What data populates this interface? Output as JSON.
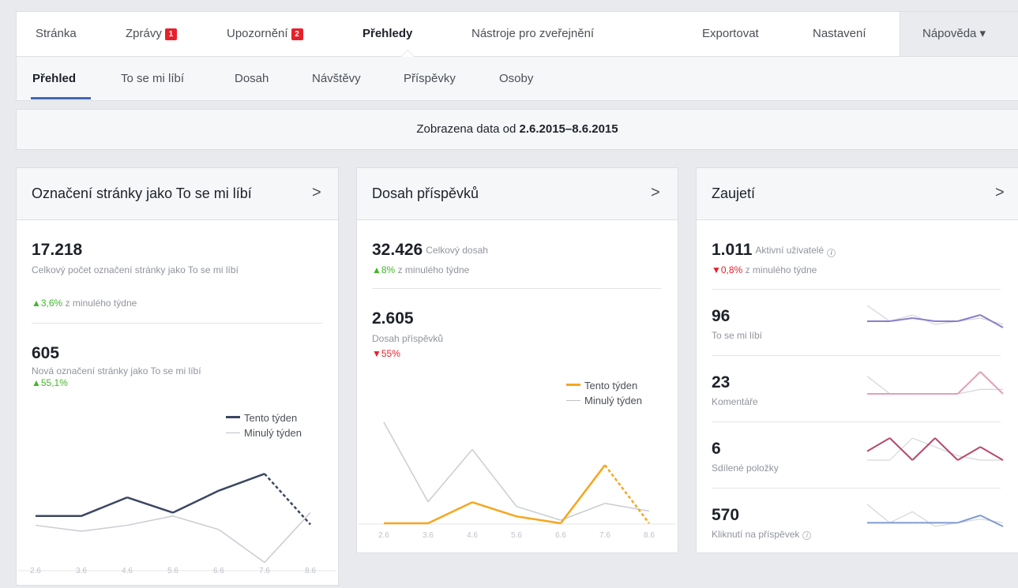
{
  "nav": {
    "items": [
      {
        "label": "Stránka"
      },
      {
        "label": "Zprávy",
        "badge": "1"
      },
      {
        "label": "Upozornění",
        "badge": "2"
      },
      {
        "label": "Přehledy"
      },
      {
        "label": "Nástroje pro zveřejnění"
      }
    ],
    "right": [
      {
        "label": "Exportovat"
      },
      {
        "label": "Nastavení"
      }
    ],
    "help": "Nápověda ▾"
  },
  "subnav": {
    "items": [
      {
        "label": "Přehled"
      },
      {
        "label": "To se mi líbí"
      },
      {
        "label": "Dosah"
      },
      {
        "label": "Návštěvy"
      },
      {
        "label": "Příspěvky"
      },
      {
        "label": "Osoby"
      }
    ]
  },
  "range": {
    "prefix": "Zobrazena data od ",
    "value": "2.6.2015–8.6.2015"
  },
  "likes_card": {
    "title": "Označení stránky jako To se mi líbí",
    "chevron": ">",
    "total": "17.218",
    "total_label": "Celkový počet označení stránky jako To se mi líbí",
    "total_change": "▲3,6%",
    "total_change_suffix": " z minulého týdne",
    "new": "605",
    "new_label": "Nová označení stránky jako To se mi líbí",
    "new_change": "▲55,1%",
    "legend_current": "Tento týden",
    "legend_previous": "Minulý týden"
  },
  "reach_card": {
    "title": "Dosah příspěvků",
    "chevron": ">",
    "total": "32.426",
    "total_label": "Celkový dosah",
    "total_change": "▲8%",
    "total_change_suffix": " z minulého týdne",
    "posts": "2.605",
    "posts_label": "Dosah příspěvků",
    "posts_change": "▼55%",
    "legend_current": "Tento týden",
    "legend_previous": "Minulý týden"
  },
  "engagement_card": {
    "title": "Zaujetí",
    "chevron": ">",
    "active": "1.011",
    "active_label": "Aktivní uživatelé",
    "active_change": "▼0,8%",
    "active_change_suffix": " z minulého týdne",
    "rows": [
      {
        "value": "96",
        "label": "To se mi líbí"
      },
      {
        "value": "23",
        "label": "Komentáře"
      },
      {
        "value": "6",
        "label": "Sdílené položky"
      },
      {
        "value": "570",
        "label": "Kliknutí na příspěvek"
      }
    ]
  },
  "colors": {
    "likes_current": "#3b4762",
    "reach_current": "#f7a61c",
    "previous": "#c9ccd2",
    "spark_likes": "#8b7fc9",
    "spark_comments": "#e3a0b8",
    "spark_shares": "#b54a6e",
    "spark_clicks": "#7f9bd3"
  },
  "chart_data": [
    {
      "type": "line",
      "x": [
        "2.6",
        "3.6",
        "4.6",
        "5.6",
        "6.6",
        "7.6",
        "8.6"
      ],
      "series": [
        {
          "name": "Tento týden",
          "values": [
            108,
            108,
            130,
            112,
            138,
            158,
            98
          ],
          "partial_last": true
        },
        {
          "name": "Minulý týden",
          "values": [
            97,
            90,
            97,
            108,
            92,
            53,
            112
          ]
        }
      ]
    },
    {
      "type": "line",
      "x": [
        "2.6",
        "3.6",
        "4.6",
        "5.6",
        "6.6",
        "7.6",
        "8.6"
      ],
      "series": [
        {
          "name": "Tento týden",
          "values": [
            0,
            0,
            550,
            180,
            0,
            1520,
            0
          ],
          "partial_last": true
        },
        {
          "name": "Minulý týden",
          "values": [
            2640,
            560,
            1930,
            440,
            80,
            520,
            320
          ]
        }
      ]
    },
    {
      "type": "line",
      "title": "To se mi líbí",
      "series": [
        {
          "name": "Tento týden",
          "values": [
            5,
            5,
            6,
            5,
            5,
            7,
            3
          ]
        },
        {
          "name": "Minulý týden",
          "values": [
            10,
            5,
            7,
            4,
            5,
            6,
            4
          ]
        }
      ]
    },
    {
      "type": "line",
      "title": "Komentáře",
      "series": [
        {
          "name": "Tento týden",
          "values": [
            3,
            3,
            3,
            3,
            3,
            8,
            3
          ]
        },
        {
          "name": "Minulý týden",
          "values": [
            7,
            3,
            3,
            3,
            3,
            4,
            4
          ]
        }
      ]
    },
    {
      "type": "line",
      "title": "Sdílené položky",
      "series": [
        {
          "name": "Tento týden",
          "values": [
            5,
            8,
            3,
            8,
            3,
            6,
            3
          ]
        },
        {
          "name": "Minulý týden",
          "values": [
            3,
            3,
            8,
            6,
            4,
            3,
            3
          ]
        }
      ]
    },
    {
      "type": "line",
      "title": "Kliknutí na příspěvek",
      "series": [
        {
          "name": "Tento týden",
          "values": [
            4,
            4,
            4,
            4,
            4,
            6,
            3
          ]
        },
        {
          "name": "Minulý týden",
          "values": [
            9,
            4,
            7,
            3,
            4,
            5,
            4
          ]
        }
      ]
    }
  ]
}
